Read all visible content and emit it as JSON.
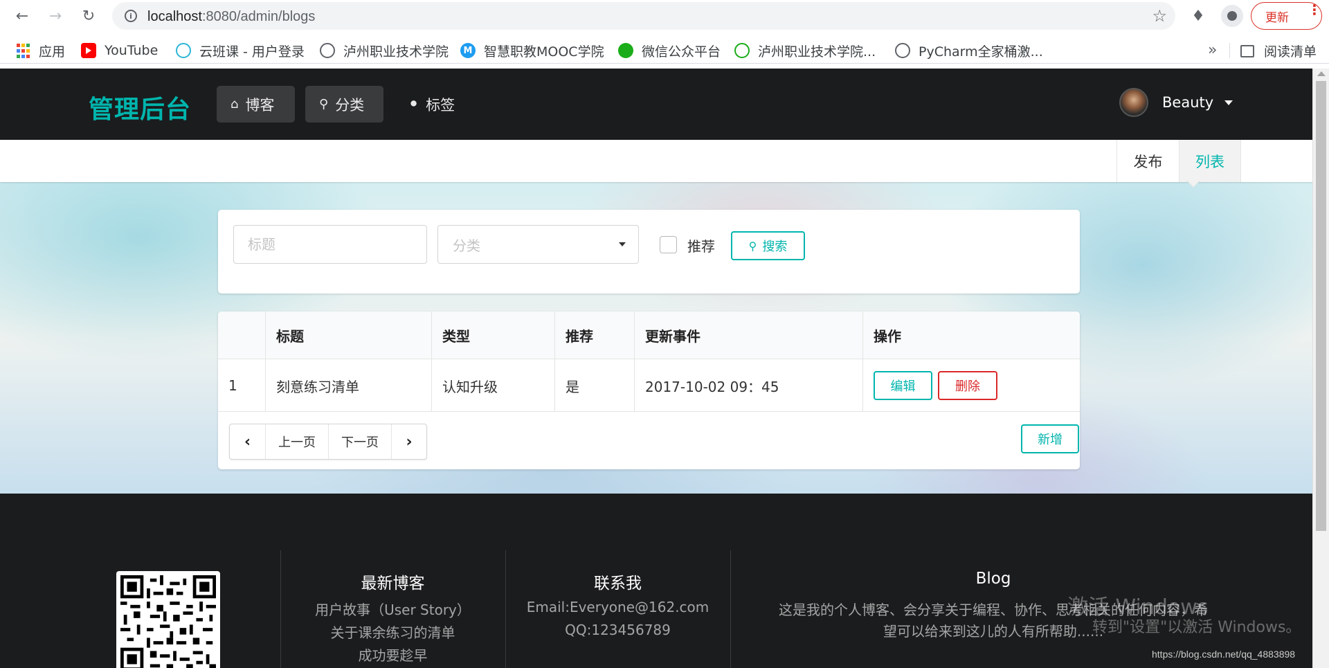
{
  "browser": {
    "url_host": "localhost",
    "url_rest": ":8080/admin/blogs",
    "update_label": "更新",
    "bookmarks": [
      {
        "label": "应用",
        "icon": "apps-grid-icon"
      },
      {
        "label": "YouTube",
        "icon": "youtube-icon"
      },
      {
        "label": "云班课 - 用户登录",
        "icon": "cloud-icon"
      },
      {
        "label": "泸州职业技术学院",
        "icon": "globe-icon"
      },
      {
        "label": "智慧职教MOOC学院",
        "icon": "m-logo-icon"
      },
      {
        "label": "微信公众平台",
        "icon": "wechat-icon"
      },
      {
        "label": "泸州职业技术学院...",
        "icon": "atom-icon"
      },
      {
        "label": "PyCharm全家桶激...",
        "icon": "globe-icon"
      }
    ],
    "more_label": "»",
    "reading_list": "阅读清单"
  },
  "navbar": {
    "brand": "管理后台",
    "items": [
      {
        "label": "博客",
        "icon": "home-icon",
        "active": true
      },
      {
        "label": "分类",
        "icon": "lightbulb-icon",
        "active": true
      },
      {
        "label": "标签",
        "icon": "tags-icon",
        "active": false
      }
    ],
    "user_name": "Beauty"
  },
  "sub_menu": {
    "items": [
      {
        "label": "发布",
        "active": false
      },
      {
        "label": "列表",
        "active": true
      }
    ]
  },
  "search": {
    "title_placeholder": "标题",
    "category_placeholder": "分类",
    "recommend_label": "推荐",
    "search_button": "搜索"
  },
  "table": {
    "headers": [
      "",
      "标题",
      "类型",
      "推荐",
      "更新事件",
      "操作"
    ],
    "rows": [
      {
        "id": "1",
        "title": "刻意练习清单",
        "type": "认知升级",
        "recommend": "是",
        "updated": "2017-10-02 09：45",
        "edit": "编辑",
        "delete": "删除"
      }
    ],
    "prev_label": "上一页",
    "next_label": "下一页",
    "add_button": "新增"
  },
  "footer": {
    "latest_title": "最新博客",
    "latest_items": [
      "用户故事（User Story）",
      "关于课余练习的清单",
      "成功要趁早"
    ],
    "contact_title": "联系我",
    "contact_email": "Email:Everyone@162.com",
    "contact_qq": "QQ:123456789",
    "blog_title": "Blog",
    "blog_desc_line1": "这是我的个人博客、会分享关于编程、协作、思考相关的任何内容，希",
    "blog_desc_line2": "望可以给来到这儿的人有所帮助......"
  },
  "overlay": {
    "watermark_line1": "激活 Windows",
    "watermark_line2": "转到\"设置\"以激活 Windows。",
    "csdn_url": "https://blog.csdn.net/qq_4883898"
  },
  "colors": {
    "accent": "#00b5ad",
    "danger": "#db2828",
    "navbar_bg": "#1b1c1d"
  }
}
